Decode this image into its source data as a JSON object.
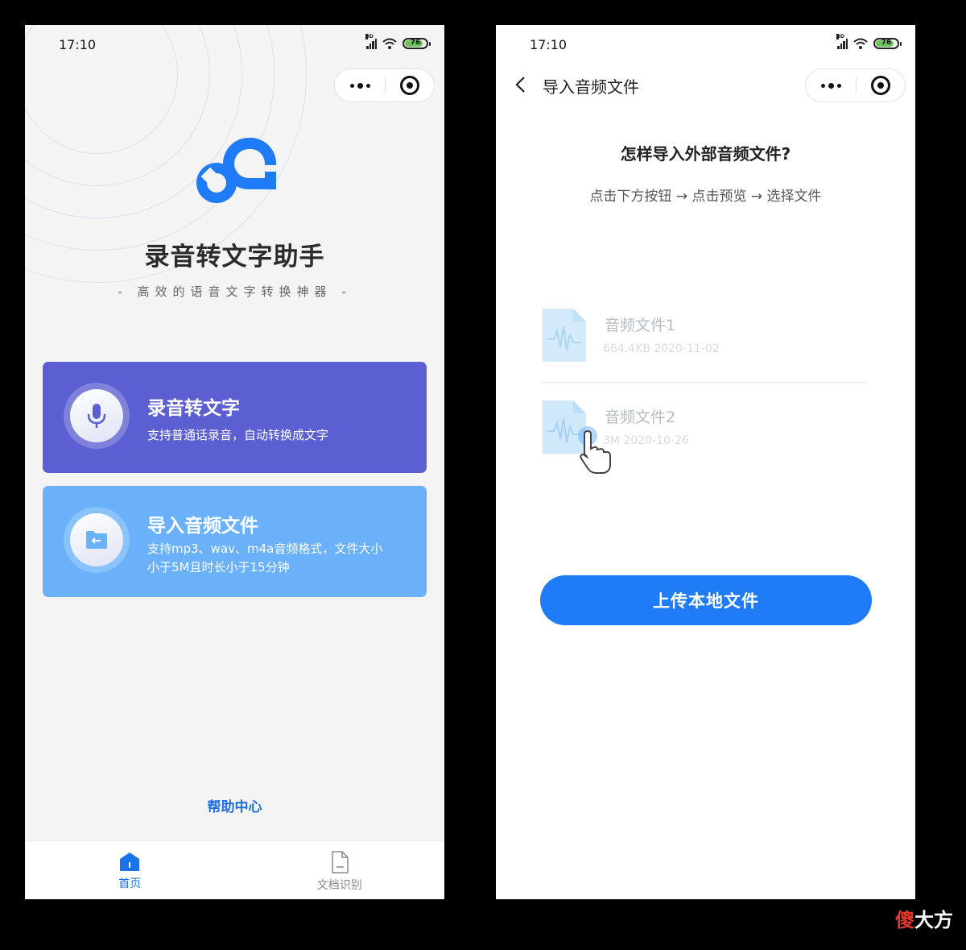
{
  "left_screen": {
    "status": {
      "time": "17:10",
      "battery": "76",
      "signal_badge": "HD"
    },
    "app_title": "录音转文字助手",
    "app_subtitle": "- 高效的语音文字转换神器 -",
    "cards": {
      "record": {
        "title": "录音转文字",
        "desc": "支持普通话录音，自动转换成文字",
        "icon": "microphone-icon"
      },
      "import": {
        "title": "导入音频文件",
        "desc": "支持mp3、wav、m4a音频格式，文件大小小于5M且时长小于15分钟",
        "icon": "folder-import-icon"
      }
    },
    "help_link": "帮助中心",
    "tabbar": [
      {
        "label": "首页",
        "icon": "home-icon",
        "active": true
      },
      {
        "label": "文档识别",
        "icon": "document-icon",
        "active": false
      }
    ]
  },
  "right_screen": {
    "status": {
      "time": "17:10",
      "battery": "76",
      "signal_badge": "HD"
    },
    "nav_title": "导入音频文件",
    "how_title": "怎样导入外部音频文件?",
    "how_steps": "点击下方按钮 → 点击预览 → 选择文件",
    "files": [
      {
        "name": "音频文件1",
        "meta": "664.4KB 2020-11-02"
      },
      {
        "name": "音频文件2",
        "meta": "3M 2020-10-26"
      }
    ],
    "upload_button": "上传本地文件"
  },
  "watermark": {
    "part1": "傻",
    "part2": "大方"
  },
  "colors": {
    "record_card": "#5b5fd1",
    "import_card": "#6ab1fa",
    "accent": "#1f7bf6",
    "help": "#1f6fe0"
  }
}
